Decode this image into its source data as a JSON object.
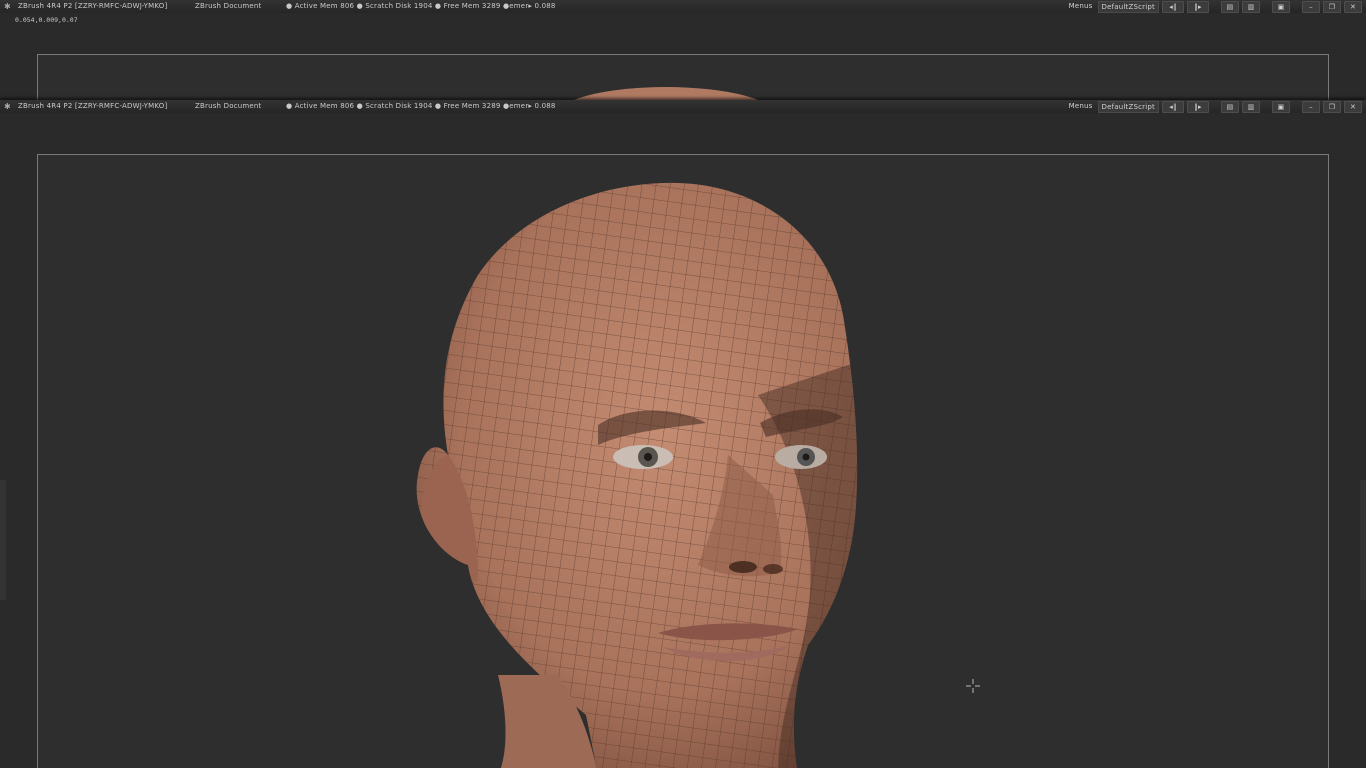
{
  "window": {
    "title": "ZBrush 4R4 P2 [ZZRY-RMFC-ADWJ-YMKO]",
    "document": "ZBrush Document",
    "memory_status": "● Active Mem 806 ● Scratch Disk 1904 ● Free Mem 3289 ●emer▸ 0.088",
    "menus_label": "Menus",
    "script_label": "DefaultZScript",
    "coords": "0.054,0.009,0.07"
  },
  "icons": {
    "app": "zbrush-logo-icon",
    "scroll_left": "scroll-left-icon",
    "scroll_right": "scroll-right-icon",
    "layout_a": "layout-icon",
    "layout_b": "layout-alt-icon",
    "lock": "lock-icon",
    "minimize": "minimize-icon",
    "restore": "restore-icon",
    "close": "close-icon"
  },
  "colors": {
    "background": "#2b2b2b",
    "titlebar": "#2d2d2d",
    "canvas_border": "#7a7a7a",
    "skin": "#b9826a",
    "wire": "#5a3a2c"
  }
}
